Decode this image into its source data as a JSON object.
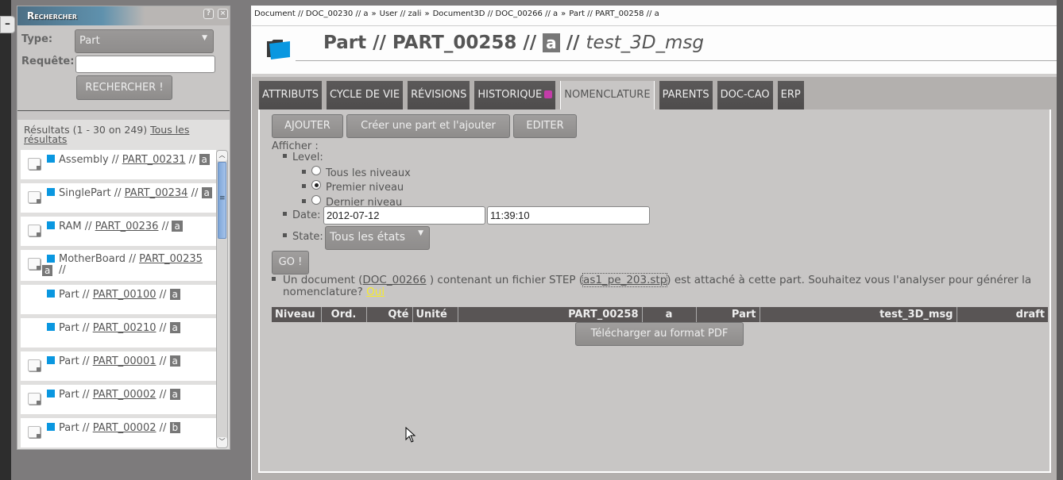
{
  "search_panel": {
    "title": "Rechercher",
    "help_icon": "?",
    "close_icon": "×",
    "type_label": "Type:",
    "type_value": "Part",
    "query_label": "Requête:",
    "query_value": "",
    "submit_label": "RECHERCHER !",
    "results_summary": "Résultats (1 - 30 on 249)",
    "all_results_link": "Tous les résultats",
    "results": [
      {
        "type": "Assembly",
        "ref": "PART_00231",
        "rev": "a",
        "has_doc_icon": true
      },
      {
        "type": "SinglePart",
        "ref": "PART_00234",
        "rev": "a",
        "has_doc_icon": true
      },
      {
        "type": "RAM",
        "ref": "PART_00236",
        "rev": "a",
        "has_doc_icon": true
      },
      {
        "type": "MotherBoard",
        "ref": "PART_00235",
        "rev": "a",
        "has_doc_icon": true
      },
      {
        "type": "Part",
        "ref": "PART_00100",
        "rev": "a",
        "has_doc_icon": false
      },
      {
        "type": "Part",
        "ref": "PART_00210",
        "rev": "a",
        "has_doc_icon": false
      },
      {
        "type": "Part",
        "ref": "PART_00001",
        "rev": "a",
        "has_doc_icon": true
      },
      {
        "type": "Part",
        "ref": "PART_00002",
        "rev": "a",
        "has_doc_icon": true
      },
      {
        "type": "Part",
        "ref": "PART_00002",
        "rev": "b",
        "has_doc_icon": true
      }
    ],
    "separator": " // "
  },
  "collapse_label": "–",
  "breadcrumb": [
    "Document // DOC_00230 // a",
    "User // zali",
    "Document3D // DOC_00266 // a",
    "Part // PART_00258 // a"
  ],
  "breadcrumb_sep": "»",
  "page": {
    "title_prefix": "Part // PART_00258 //",
    "revision": "a",
    "title_sep": "//",
    "name": "test_3D_msg"
  },
  "tabs": [
    {
      "label": "ATTRIBUTS",
      "active": false
    },
    {
      "label": "CYCLE DE VIE",
      "active": false
    },
    {
      "label": "RÉVISIONS",
      "active": false
    },
    {
      "label": "HISTORIQUE",
      "active": false,
      "rss": true
    },
    {
      "label": "NOMENCLATURE",
      "active": true
    },
    {
      "label": "PARENTS",
      "active": false
    },
    {
      "label": "DOC-CAO",
      "active": false
    },
    {
      "label": "ERP",
      "active": false
    }
  ],
  "nomenclature": {
    "buttons": {
      "add": "AJOUTER",
      "create_and_add": "Créer une part et l'ajouter",
      "edit": "EDITER",
      "go": "GO !",
      "pdf": "Télécharger au format PDF"
    },
    "afficher_label": "Afficher :",
    "level_label": "Level:",
    "level_options": [
      {
        "label": "Tous les niveaux",
        "checked": false
      },
      {
        "label": "Premier niveau",
        "checked": true
      },
      {
        "label": "Dernier niveau",
        "checked": false
      }
    ],
    "date_label": "Date:",
    "date_value": "2012-07-12",
    "time_value": "11:39:10",
    "state_label": "State:",
    "state_value": "Tous les états",
    "step_message": {
      "part1": "Un document (",
      "doc_link": "DOC_00266",
      "part2": " ) contenant un fichier STEP (",
      "file_link": "as1_pe_203.stp",
      "part3": ") est attaché à cette part. Souhaitez vous l'analyser pour générer la nomenclature? ",
      "yes_link": "Oui"
    },
    "table_headers": [
      "Niveau",
      "Ord.",
      "Qté",
      "Unité",
      "PART_00258",
      "a",
      "Part",
      "test_3D_msg",
      "draft"
    ]
  },
  "colors": {
    "accent_blue": "#0a97e0",
    "tab_dark": "#555353",
    "yes_link": "#f6ec2c",
    "rss": "#c33ca8"
  }
}
